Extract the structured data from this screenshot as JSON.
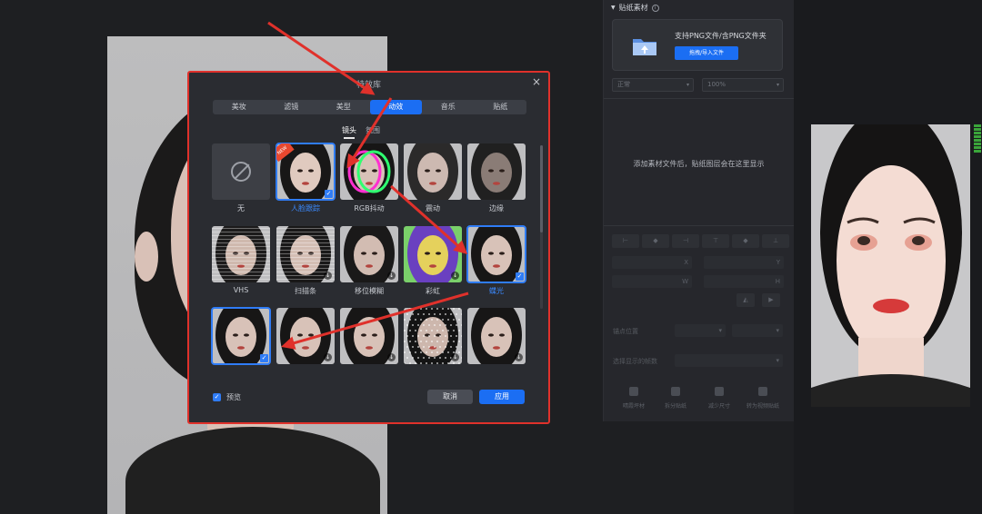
{
  "dialog": {
    "title": "特效库",
    "close_glyph": "×",
    "tabs": [
      {
        "label": "美妆",
        "active": false
      },
      {
        "label": "滤镜",
        "active": false
      },
      {
        "label": "美型",
        "active": false
      },
      {
        "label": "动效",
        "active": true
      },
      {
        "label": "音乐",
        "active": false
      },
      {
        "label": "贴纸",
        "active": false
      }
    ],
    "subtabs": [
      {
        "label": "镜头",
        "active": true
      },
      {
        "label": "氛围",
        "active": false
      }
    ],
    "effects": [
      {
        "label": "无",
        "kind": "none"
      },
      {
        "label": "人脸跟踪",
        "kind": "new",
        "selected": true,
        "blue": true,
        "new_badge": "NEW"
      },
      {
        "label": "RGB抖动",
        "kind": "rgb"
      },
      {
        "label": "震动",
        "kind": "blur"
      },
      {
        "label": "边缘",
        "kind": "edge"
      },
      {
        "label": "VHS",
        "kind": "vhs"
      },
      {
        "label": "扫描条",
        "kind": "scan",
        "download": true
      },
      {
        "label": "移位模糊",
        "kind": "shift",
        "download": true
      },
      {
        "label": "彩虹",
        "kind": "rainbow",
        "download": true
      },
      {
        "label": "蝶光",
        "kind": "plain",
        "selected": true,
        "blue": true
      },
      {
        "label": "",
        "kind": "plain",
        "selected": true
      },
      {
        "label": "",
        "kind": "plain",
        "download": true
      },
      {
        "label": "",
        "kind": "plain",
        "download": true
      },
      {
        "label": "",
        "kind": "mosaic",
        "download": true
      },
      {
        "label": "",
        "kind": "plain",
        "download": true
      }
    ],
    "preview_label": "预览",
    "check_glyph": "✓",
    "cancel_label": "取消",
    "apply_label": "应用"
  },
  "sticker_panel": {
    "header": "贴纸素材",
    "info_glyph": "i",
    "upload_text": "支持PNG文件/含PNG文件夹",
    "upload_button": "拖拽/导入文件",
    "blend_mode": "正常",
    "opacity": "100%",
    "empty_message": "添加素材文件后，贴纸图层会在这里显示",
    "x_label": "X",
    "y_label": "Y",
    "w_label": "W",
    "h_label": "H",
    "anchor_label": "锚点位置",
    "frame_label": "选择显示的帧数",
    "bottom_actions": [
      "晴霞坪材",
      "拆分贴纸",
      "减少尺寸",
      "转为视频贴纸"
    ]
  },
  "colors": {
    "accent": "#1b6ef3",
    "annotation": "#e0312b"
  }
}
